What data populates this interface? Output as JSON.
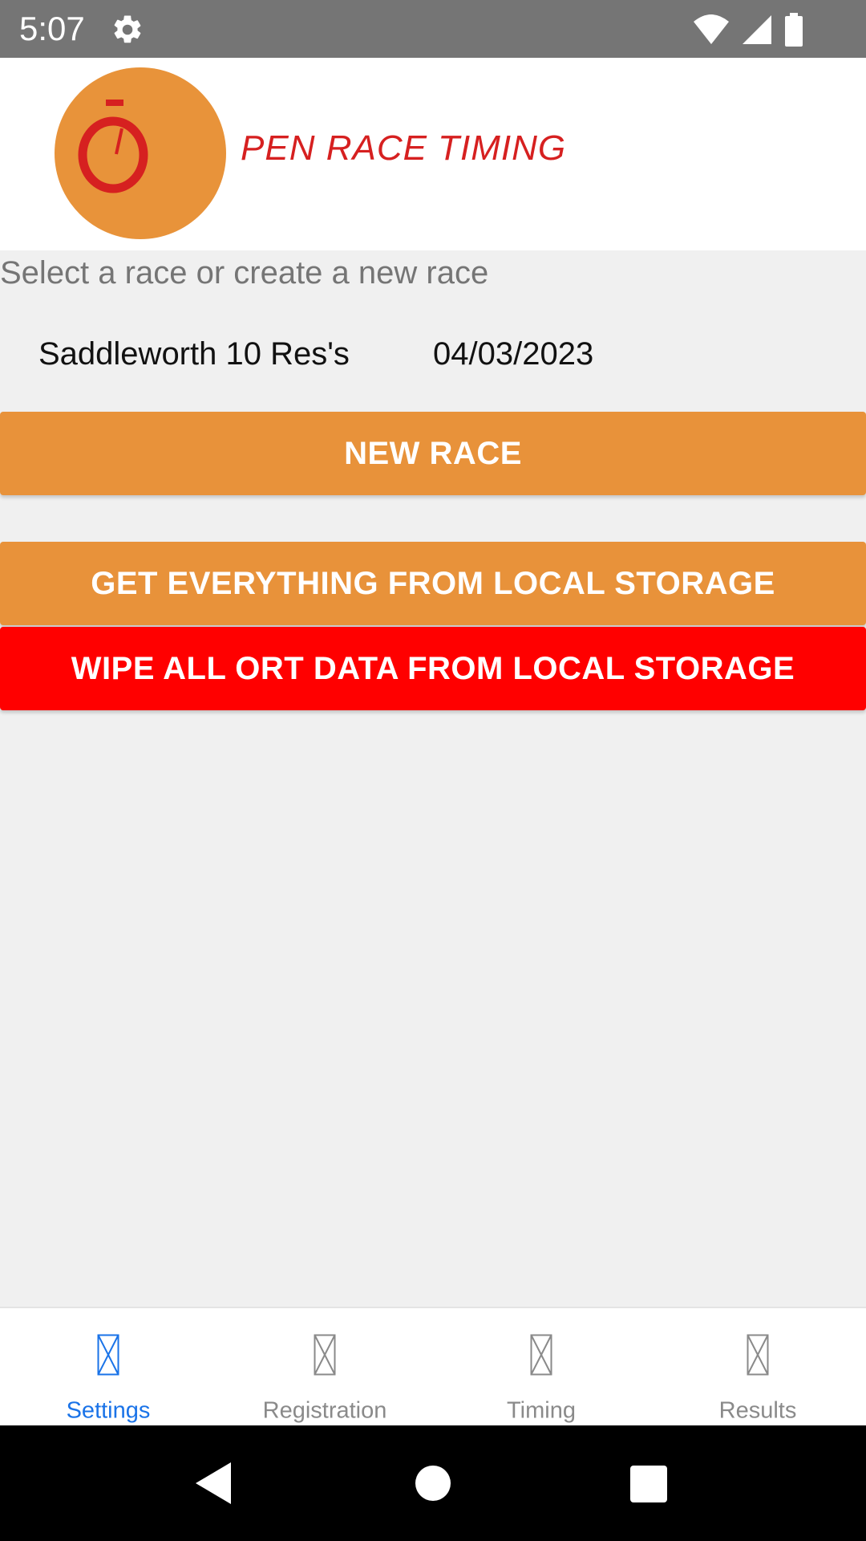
{
  "status_bar": {
    "time": "5:07",
    "icons": [
      "gear-icon",
      "wifi-icon",
      "cell-signal-icon",
      "battery-icon"
    ]
  },
  "header": {
    "logo_text": "PEN RACE TIMING",
    "logo_colors": {
      "circle": "#e8933a",
      "text": "#d62020"
    }
  },
  "main": {
    "prompt": "Select a race or create a new race",
    "races": [
      {
        "name": "Saddleworth 10 Res's",
        "date": "04/03/2023"
      }
    ],
    "new_race_label": "NEW RACE",
    "get_all_label": "GET EVERYTHING FROM LOCAL STORAGE",
    "wipe_label": "WIPE ALL ORT DATA FROM LOCAL STORAGE"
  },
  "colors": {
    "accent": "#e8923a",
    "danger": "#ff0000",
    "active_tab": "#1a73e8",
    "inactive_tab": "#8a8a8a"
  },
  "tabs": [
    {
      "label": "Settings",
      "active": true
    },
    {
      "label": "Registration",
      "active": false
    },
    {
      "label": "Timing",
      "active": false
    },
    {
      "label": "Results",
      "active": false
    }
  ]
}
